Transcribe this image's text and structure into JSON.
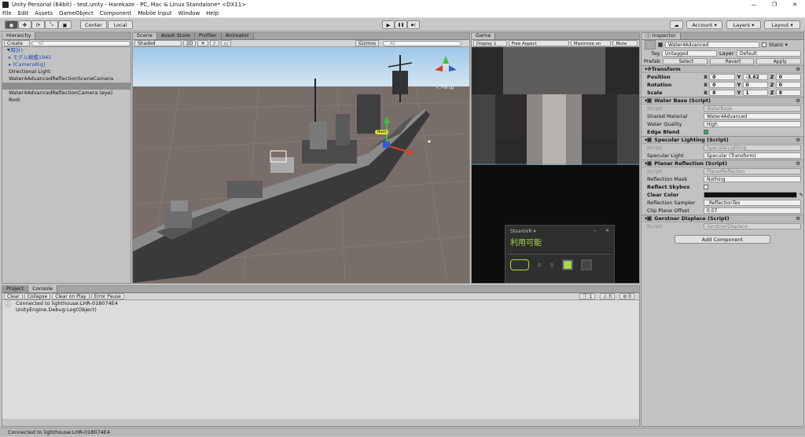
{
  "window": {
    "title": "Unity Personal (64bit) - test.unity - Harekaze - PC, Mac & Linux Standalone* <DX11>",
    "controls": [
      "—",
      "❐",
      "✕"
    ]
  },
  "menu": [
    "File",
    "Edit",
    "Assets",
    "GameObject",
    "Component",
    "Mobile Input",
    "Window",
    "Help"
  ],
  "toolbar": {
    "tools": [
      "◉",
      "✥",
      "⟳",
      "⤡",
      "▣"
    ],
    "pivot": "Center",
    "space": "Local",
    "play": "▶",
    "pause": "❚❚",
    "step": "▶|",
    "account": "Account",
    "layers": "Layers",
    "layout": "Layout"
  },
  "hierarchy": {
    "tab": "Hierarchy",
    "create": "Create",
    "search_placeholder": "All",
    "items": [
      {
        "label": "(時計)",
        "style": "blue"
      },
      {
        "label": "モデル戦艦1945",
        "style": "blue"
      },
      {
        "label": "[CameraRig]",
        "style": "blue"
      },
      {
        "label": "Directional Light",
        "style": ""
      },
      {
        "label": "Water4AdvancedReflectionSceneCamera",
        "style": ""
      },
      {
        "label": "",
        "style": "sel"
      },
      {
        "label": "Water4AdvancedReflectionCamera (eye)",
        "style": ""
      },
      {
        "label": "Root",
        "style": ""
      }
    ]
  },
  "scene": {
    "tabs": [
      "Scene",
      "Asset Store",
      "Profiler",
      "Animator"
    ],
    "shading": "Shaded",
    "mode_2d": "2D",
    "gizmos": "Gizmos",
    "search_placeholder": "All",
    "persp": "≺ Persp",
    "root_label": "Root"
  },
  "game": {
    "tab": "Game",
    "display": "Display 1",
    "aspect": "Free Aspect",
    "maximize": "Maximize on Play",
    "mute": "Mute aud"
  },
  "steamvr": {
    "title": "SteamVR ▾",
    "status": "利用可能",
    "controls": [
      "‒",
      "✕"
    ]
  },
  "console": {
    "tabs": [
      "Project",
      "Console"
    ],
    "buttons": [
      "Clear",
      "Collapse",
      "Clear on Play",
      "Error Pause"
    ],
    "counts": [
      "1",
      "0",
      "0"
    ],
    "messages": [
      "Connected to lighthouse:LHR-018074E4",
      "UnityEngine.Debug:Log(Object)"
    ]
  },
  "inspector": {
    "tab": "Inspector",
    "object_name": "Water4Advanced",
    "static_label": "Static",
    "tag_label": "Tag",
    "tag": "Untagged",
    "layer_label": "Layer",
    "layer": "Default",
    "prefab_label": "Prefab",
    "prefab_buttons": [
      "Select",
      "Revert",
      "Apply"
    ],
    "transform": {
      "title": "Transform",
      "rows": [
        {
          "label": "Position",
          "x": "0",
          "y": "-3.62",
          "z": "0"
        },
        {
          "label": "Rotation",
          "x": "0",
          "y": "0",
          "z": "0"
        },
        {
          "label": "Scale",
          "x": "8",
          "y": "1",
          "z": "8"
        }
      ]
    },
    "water_base": {
      "title": "Water Base (Script)",
      "script_label": "Script",
      "script": "WaterBase",
      "material_label": "Shared Material",
      "material": "Water4Advanced",
      "quality_label": "Water Quality",
      "quality": "High",
      "edge_label": "Edge Blend"
    },
    "specular": {
      "title": "Specular Lighting (Script)",
      "script_label": "Script",
      "script": "SpecularLighting",
      "light_label": "Specular Light",
      "light": "Specular (Transform)"
    },
    "planar": {
      "title": "Planar Reflection (Script)",
      "script_label": "Script",
      "script": "PlanarReflection",
      "mask_label": "Reflection Mask",
      "mask": "Nothing",
      "skybox_label": "Reflect Skybox",
      "clear_label": "Clear Color",
      "sampler_label": "Reflection Sampler",
      "sampler": "_ReflectionTex",
      "clip_label": "Clip Plane Offset",
      "clip": "0.07"
    },
    "gerstner": {
      "title": "Gerstner Displace (Script)",
      "script_label": "Script",
      "script": "GerstnerDisplace"
    },
    "add_component": "Add Component"
  },
  "status": "Connected to lighthouse:LHR-018074E4",
  "colors": {
    "accent": "#a8d84a",
    "selection": "#8e8e8e"
  }
}
